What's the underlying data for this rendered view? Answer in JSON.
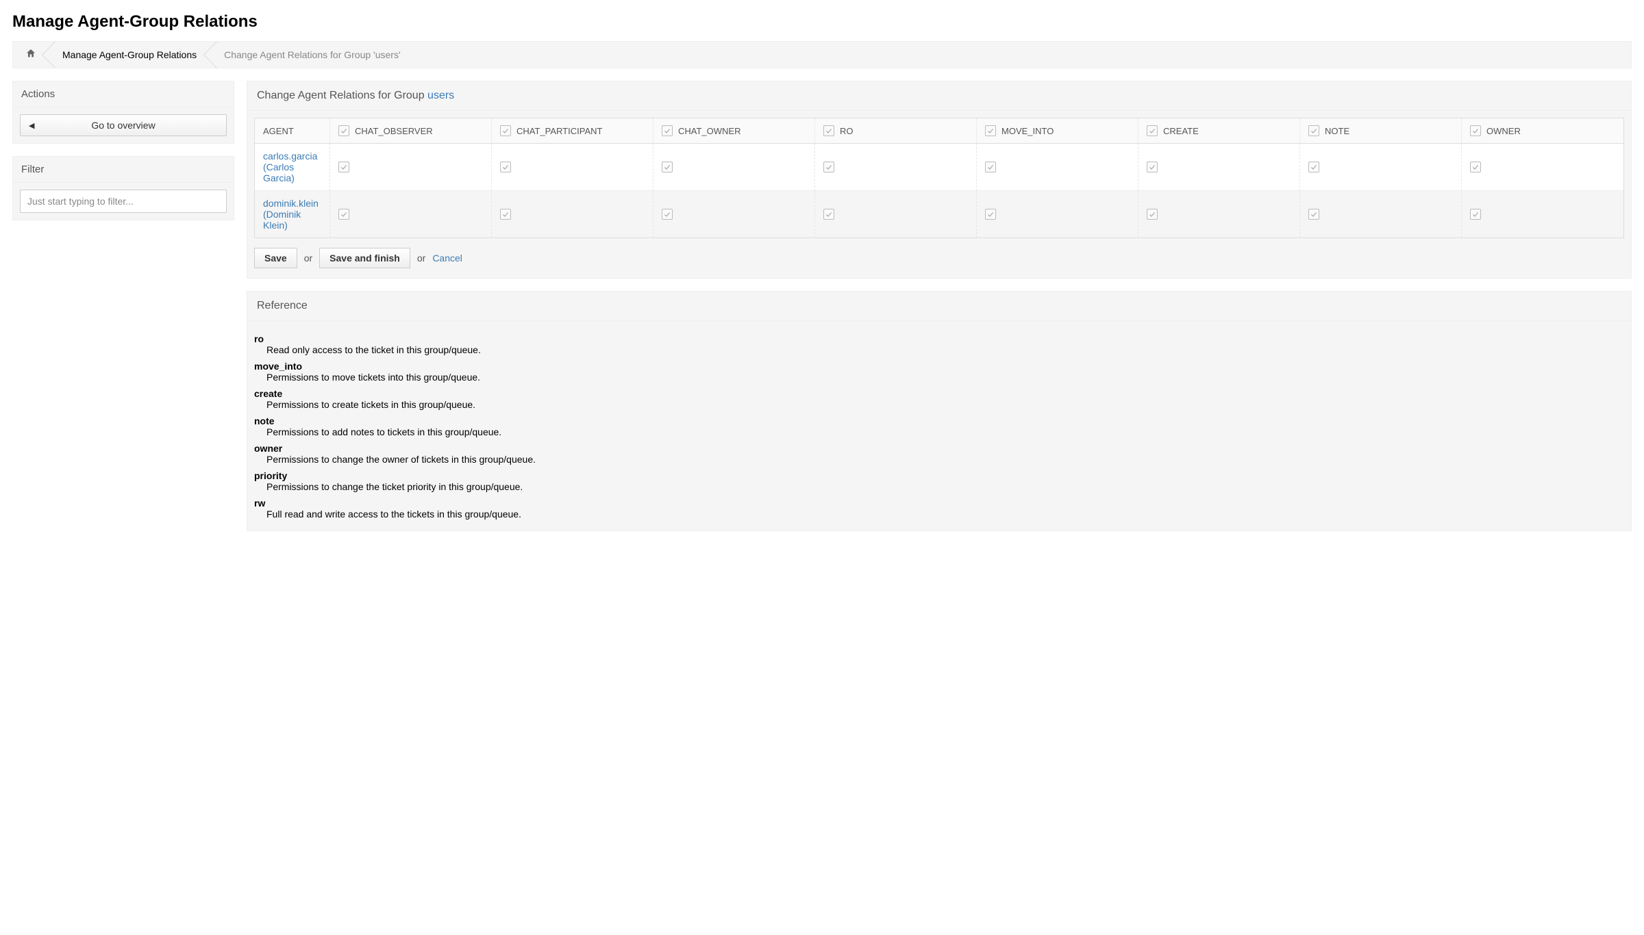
{
  "page_title": "Manage Agent-Group Relations",
  "breadcrumb": {
    "items": [
      {
        "label": "Manage Agent-Group Relations"
      },
      {
        "label": "Change Agent Relations for Group 'users'"
      }
    ]
  },
  "sidebar": {
    "actions": {
      "title": "Actions",
      "overview_button": "Go to overview"
    },
    "filter": {
      "title": "Filter",
      "placeholder": "Just start typing to filter..."
    }
  },
  "main": {
    "header_prefix": "Change Agent Relations for Group ",
    "group_name": "users",
    "table": {
      "agent_header": "AGENT",
      "columns": [
        "CHAT_OBSERVER",
        "CHAT_PARTICIPANT",
        "CHAT_OWNER",
        "RO",
        "MOVE_INTO",
        "CREATE",
        "NOTE",
        "OWNER"
      ],
      "agents": [
        {
          "username": "carlos.garcia",
          "realname": "(Carlos Garcia)"
        },
        {
          "username": "dominik.klein",
          "realname": "(Dominik Klein)"
        }
      ]
    },
    "buttons": {
      "save": "Save",
      "or1": "or",
      "save_finish": "Save and finish",
      "or2": "or",
      "cancel": "Cancel"
    },
    "reference": {
      "title": "Reference",
      "items": [
        {
          "term": "ro",
          "desc": "Read only access to the ticket in this group/queue."
        },
        {
          "term": "move_into",
          "desc": "Permissions to move tickets into this group/queue."
        },
        {
          "term": "create",
          "desc": "Permissions to create tickets in this group/queue."
        },
        {
          "term": "note",
          "desc": "Permissions to add notes to tickets in this group/queue."
        },
        {
          "term": "owner",
          "desc": "Permissions to change the owner of tickets in this group/queue."
        },
        {
          "term": "priority",
          "desc": "Permissions to change the ticket priority in this group/queue."
        },
        {
          "term": "rw",
          "desc": "Full read and write access to the tickets in this group/queue."
        }
      ]
    }
  }
}
